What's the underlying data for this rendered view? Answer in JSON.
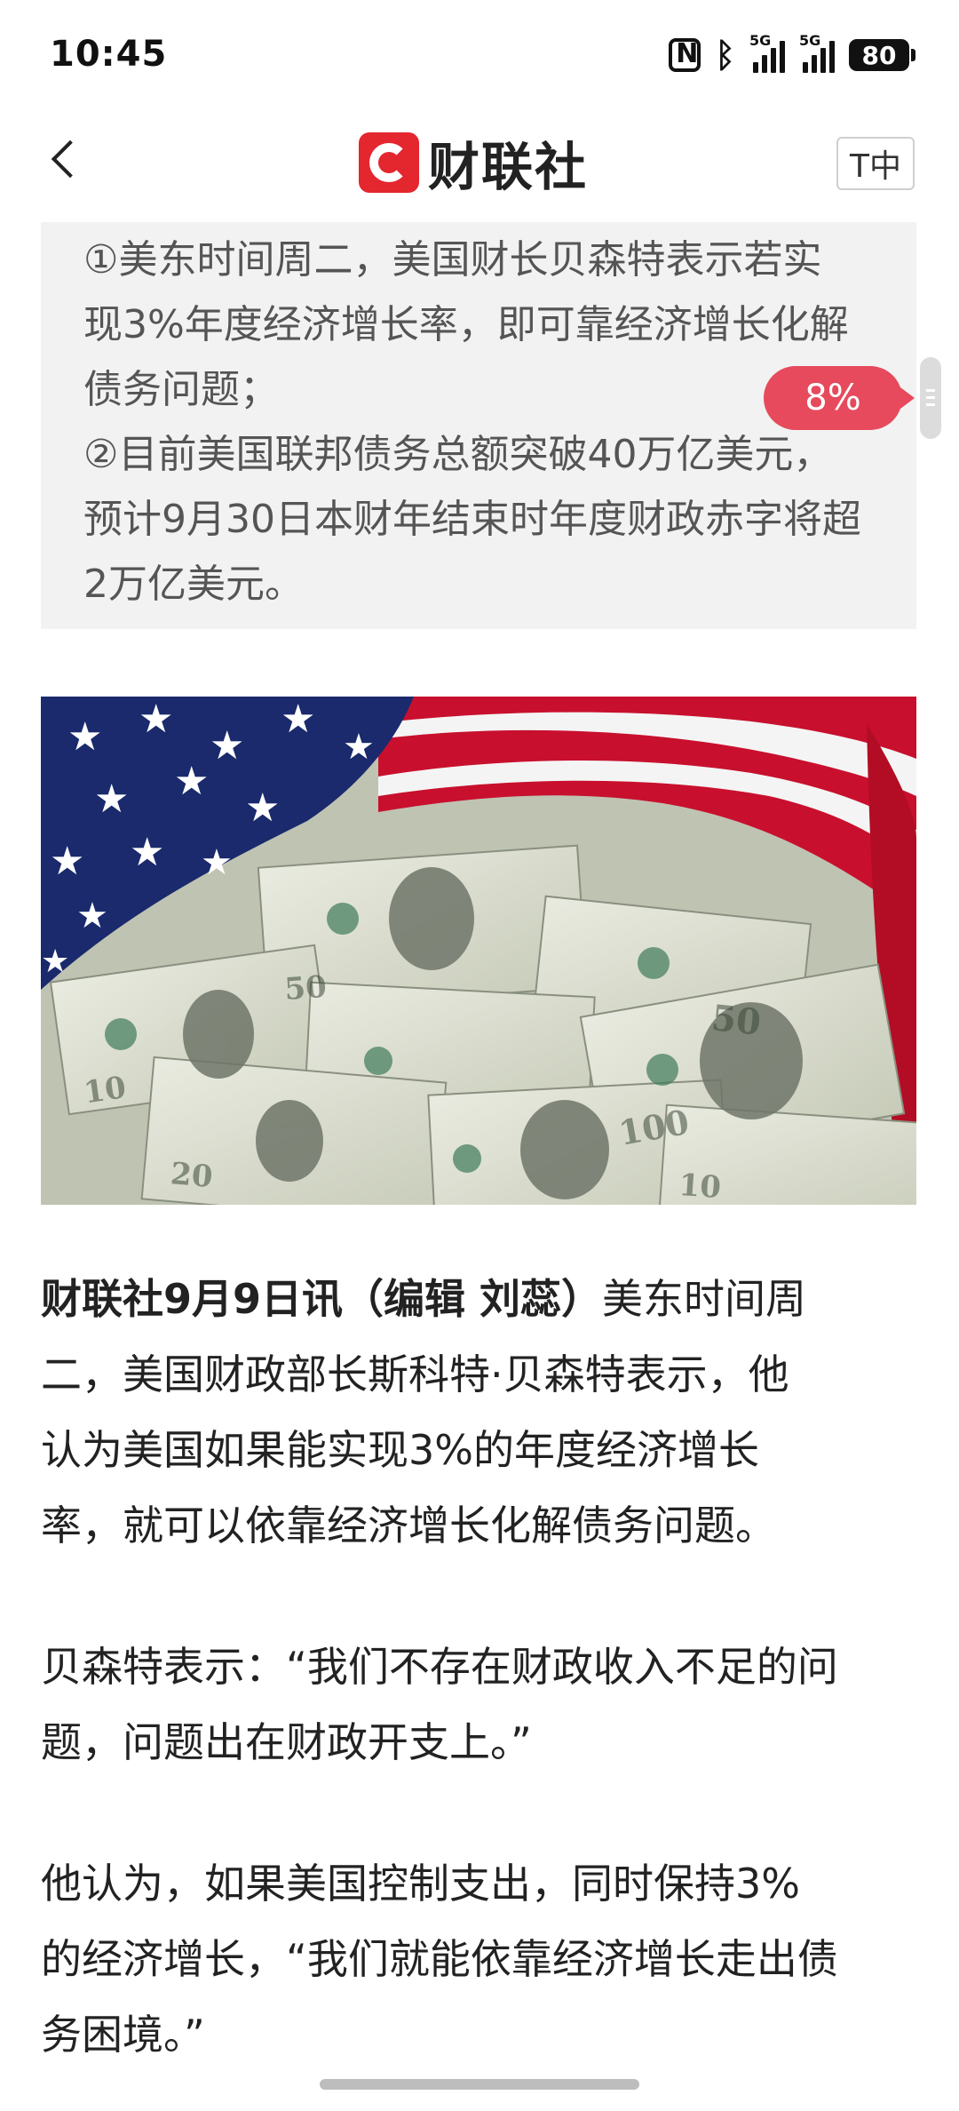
{
  "status_bar": {
    "time": "10:45",
    "battery": "80",
    "network_1": "5G",
    "network_2": "5G",
    "icons": [
      "nfc-icon",
      "bluetooth-icon",
      "signal-icon",
      "signal-icon",
      "battery-icon"
    ]
  },
  "header": {
    "brand_name": "财联社",
    "font_size_button": "T中",
    "icons": [
      "back-arrow-icon",
      "cls-logo-icon"
    ],
    "brand_color": "#e4262e"
  },
  "summary": {
    "lines": [
      "①美东时间周二，美国财长贝森特表示若实",
      "现3%年度经济增长率，即可靠经济增长化解",
      "债务问题；",
      "②目前美国联邦债务总额突破40万亿美元，",
      "预计9月30日本财年结束时年度财政赤字将超",
      "2万亿美元。"
    ]
  },
  "reading_progress": "8%",
  "article": {
    "paragraphs": [
      {
        "lead": "财联社9月9日讯（编辑 刘蕊）",
        "first_line_rest": "美东时间周",
        "lines": [
          "二，美国财政部长斯科特·贝森特表示，他",
          "认为美国如果能实现3%的年度经济增长",
          "率，就可以依靠经济增长化解债务问题。"
        ]
      },
      {
        "lines": [
          "贝森特表示：“我们不存在财政收入不足的问",
          "题，问题出在财政开支上。”"
        ]
      },
      {
        "lines": [
          "他认为，如果美国控制支出，同时保持3%",
          "的经济增长，“我们就能依靠经济增长走出债",
          "务困境。”"
        ]
      }
    ]
  },
  "colors": {
    "badge": "#e64a5c",
    "summary_bg": "#f2f2f2",
    "flag_red": "#c8102e",
    "flag_blue": "#1a2a6c"
  }
}
